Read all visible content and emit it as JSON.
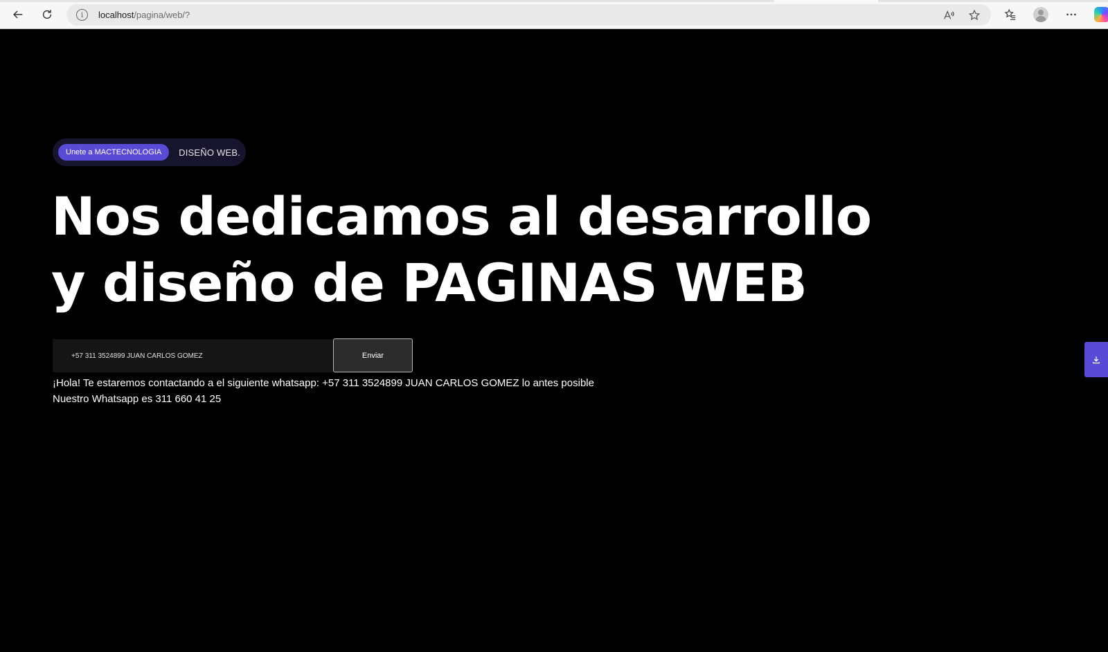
{
  "browser": {
    "url_host": "localhost",
    "url_path": "/pagina/web/?"
  },
  "hero": {
    "badge_label": "Unete a MACTECNOLOGIA",
    "badge_text": "DISEÑO WEB.",
    "headline_line1": "Nos dedicamos al desarrollo",
    "headline_line2": "y diseño de PAGINAS WEB"
  },
  "form": {
    "phone_value": "+57 311 3524899 JUAN CARLOS GOMEZ",
    "submit_label": "Enviar"
  },
  "messages": {
    "confirmation": "¡Hola! Te estaremos contactando a el siguiente whatsapp: +57 311 3524899 JUAN CARLOS GOMEZ lo antes posible",
    "whatsapp_info": "Nuestro Whatsapp es 311 660 41 25"
  },
  "colors": {
    "accent": "#5a4bd6",
    "page_background": "#000000",
    "pill_background": "#17152e"
  },
  "icons": {
    "back": "back-arrow-icon",
    "refresh": "refresh-icon",
    "site_info": "info-icon",
    "read_aloud": "read-aloud-icon",
    "favorite": "star-icon",
    "favorites_list": "favorites-icon",
    "profile": "profile-icon",
    "more": "more-icon",
    "copilot": "copilot-icon",
    "download": "download-icon"
  }
}
